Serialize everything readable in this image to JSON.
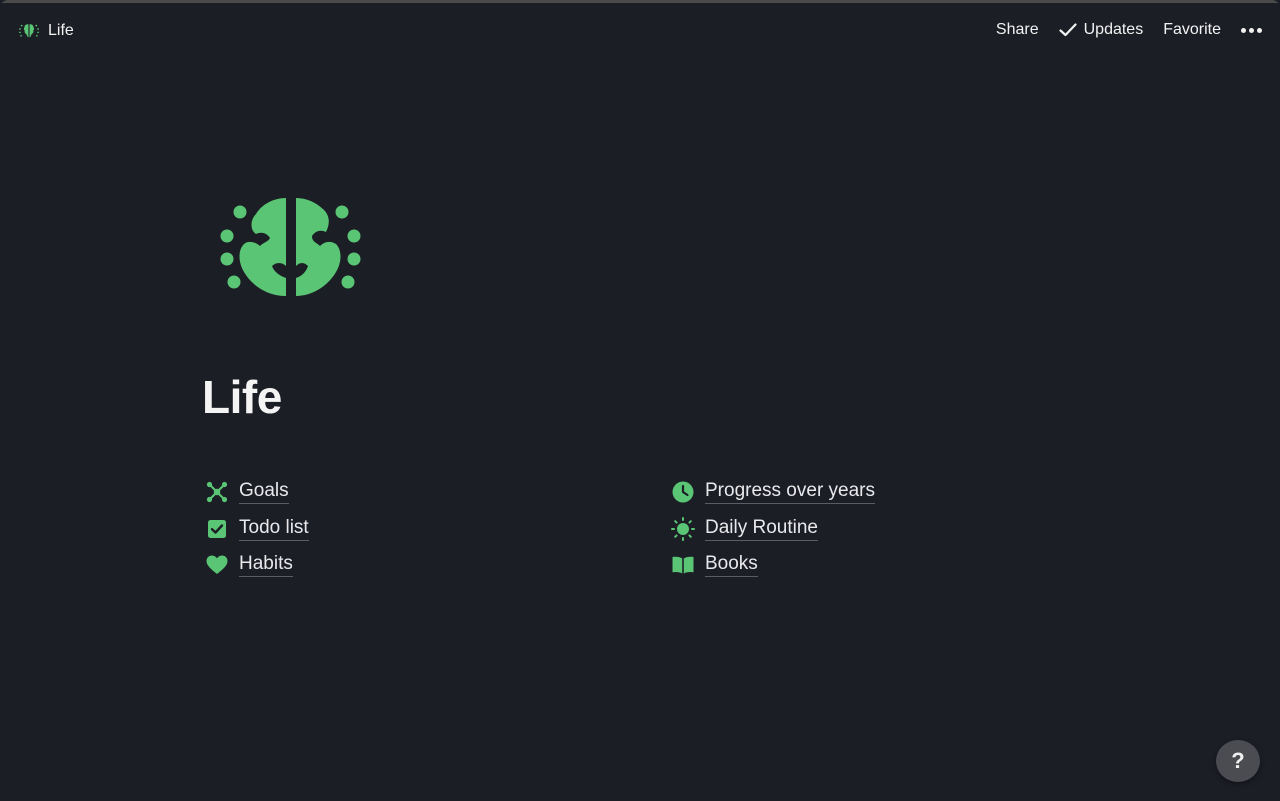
{
  "colors": {
    "background": "#1c1e26",
    "accent": "#5ac574",
    "text": "#f2f2f2"
  },
  "breadcrumb": {
    "label": "Life",
    "icon": "brain-icon"
  },
  "topbar": {
    "share_label": "Share",
    "updates_label": "Updates",
    "favorite_label": "Favorite",
    "more_icon": "more-horizontal-icon"
  },
  "page": {
    "icon": "brain-icon",
    "title": "Life"
  },
  "links": {
    "left": [
      {
        "label": "Goals",
        "icon": "network-icon"
      },
      {
        "label": "Todo list",
        "icon": "checkbox-icon"
      },
      {
        "label": "Habits",
        "icon": "heart-icon"
      }
    ],
    "right": [
      {
        "label": "Progress over years",
        "icon": "clock-icon"
      },
      {
        "label": "Daily Routine",
        "icon": "sun-icon"
      },
      {
        "label": "Books",
        "icon": "book-icon"
      }
    ]
  },
  "help": {
    "label": "?"
  }
}
